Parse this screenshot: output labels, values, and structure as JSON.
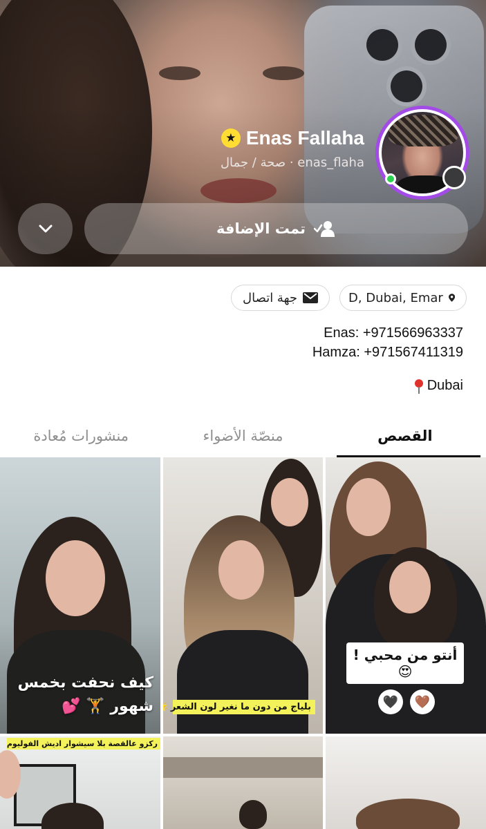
{
  "profile": {
    "display_name": "Enas Fallaha",
    "subtitle": "enas_flaha · صحة / جمال",
    "added_label": "تمت الإضافة"
  },
  "info": {
    "location_chip": "D, Dubai, Emar",
    "contact_chip": "جهة اتصال",
    "contact_lines": [
      "Enas: +971566963337",
      "Hamza: +971567411319"
    ],
    "city": "Dubai"
  },
  "tabs": [
    {
      "label": "القصص",
      "active": true
    },
    {
      "label": "منصّة الأضواء",
      "active": false
    },
    {
      "label": "منشورات مُعادة",
      "active": false
    }
  ],
  "grid": {
    "tile1_caption": "كيف نحفت بخمس شهور 🏋️ 💕",
    "tile2_caption": "بلياج من دون ما نغير لون الشعر 🌟💕",
    "tile3_caption": "أنتو من محبي ! 😍",
    "tile3_hearts": [
      "🖤",
      "🤎"
    ],
    "tile4_caption": "ركزو عالقصة بلا سيشوار اديش الفوليوم فيها حلو ✨💕"
  },
  "colors": {
    "story_ring": "#a24be6",
    "online": "#2bd34f",
    "star_badge": "#ffdd33",
    "caption_yellow": "#f4f25a"
  },
  "icons": {
    "star": "star-icon",
    "user_check": "user-check-icon",
    "chevron": "chevron-down-icon",
    "location": "location-pin-icon",
    "mail": "mail-icon",
    "pin": "red-pin-icon"
  }
}
